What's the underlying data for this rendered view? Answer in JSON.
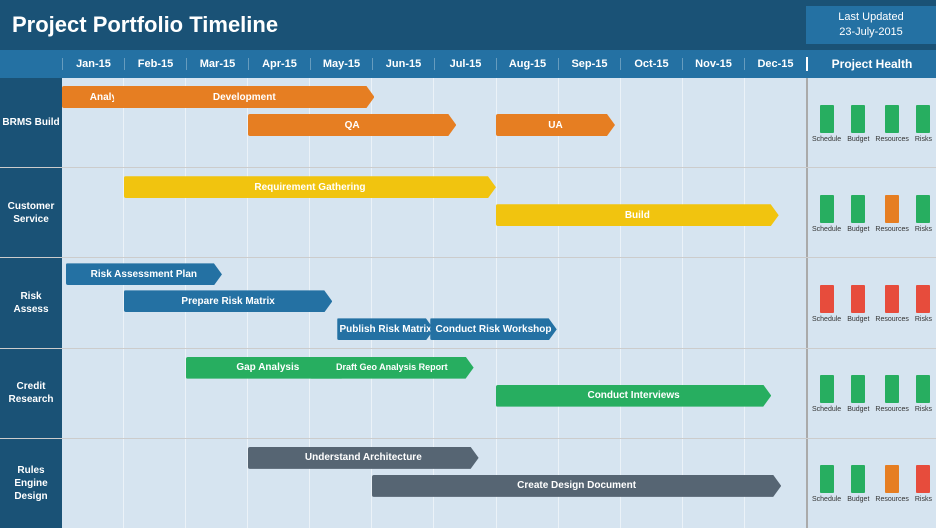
{
  "header": {
    "title": "Project Portfolio Timeline",
    "last_updated_label": "Last Updated",
    "last_updated_date": "23-July-2015",
    "project_health_label": "Project Health"
  },
  "months": [
    "Jan-15",
    "Feb-15",
    "Mar-15",
    "Apr-15",
    "May-15",
    "Jun-15",
    "Jul-15",
    "Aug-15",
    "Sep-15",
    "Oct-15",
    "Nov-15",
    "Dec-15"
  ],
  "rows": [
    {
      "id": "brms-build",
      "label": "BRMS Build",
      "bars": [
        {
          "label": "Analysis",
          "color": "#e67e22",
          "left_pct": 0,
          "width_pct": 14
        },
        {
          "label": "Development",
          "color": "#e67e22",
          "left_pct": 8,
          "width_pct": 35
        },
        {
          "label": "QA",
          "color": "#e67e22",
          "left_pct": 25,
          "width_pct": 30
        },
        {
          "label": "UA",
          "color": "#e67e22",
          "left_pct": 58,
          "width_pct": 18
        }
      ],
      "health": [
        {
          "label": "Schedule",
          "height": 28,
          "color": "bar-green"
        },
        {
          "label": "Budget",
          "height": 28,
          "color": "bar-green"
        },
        {
          "label": "Resources",
          "height": 28,
          "color": "bar-green"
        },
        {
          "label": "Risks",
          "height": 28,
          "color": "bar-green"
        }
      ]
    },
    {
      "id": "customer-service",
      "label": "Customer Service",
      "bars": [
        {
          "label": "Requirement Gathering",
          "color": "#f1c40f",
          "left_pct": 8.33,
          "width_pct": 52
        },
        {
          "label": "Build",
          "color": "#f1c40f",
          "left_pct": 58.33,
          "width_pct": 40
        }
      ],
      "health": [
        {
          "label": "Schedule",
          "height": 28,
          "color": "bar-green"
        },
        {
          "label": "Budget",
          "height": 28,
          "color": "bar-green"
        },
        {
          "label": "Resources",
          "height": 28,
          "color": "bar-orange"
        },
        {
          "label": "Risks",
          "height": 28,
          "color": "bar-green"
        }
      ]
    },
    {
      "id": "risk-assess",
      "label": "Risk Assess",
      "bars": [
        {
          "label": "Risk Assessment Plan",
          "color": "#2471a3",
          "left_pct": 0,
          "width_pct": 22
        },
        {
          "label": "Prepare Risk Matrix",
          "color": "#2471a3",
          "left_pct": 8.33,
          "width_pct": 30
        },
        {
          "label": "Publish Risk Matrix",
          "color": "#2471a3",
          "left_pct": 38.33,
          "width_pct": 13
        },
        {
          "label": "Conduct Risk Workshop",
          "color": "#2471a3",
          "left_pct": 50,
          "width_pct": 16
        }
      ],
      "health": [
        {
          "label": "Schedule",
          "height": 28,
          "color": "bar-red"
        },
        {
          "label": "Budget",
          "height": 28,
          "color": "bar-red"
        },
        {
          "label": "Resources",
          "height": 28,
          "color": "bar-red"
        },
        {
          "label": "Risks",
          "height": 28,
          "color": "bar-red"
        }
      ]
    },
    {
      "id": "credit-research",
      "label": "Credit Research",
      "bars": [
        {
          "label": "Gap Analysis",
          "color": "#27ae60",
          "left_pct": 16.67,
          "width_pct": 25
        },
        {
          "label": "Draft Geo Analysis Report",
          "color": "#27ae60",
          "left_pct": 33.33,
          "width_pct": 25
        },
        {
          "label": "Conduct Interviews",
          "color": "#27ae60",
          "left_pct": 58.33,
          "width_pct": 38
        }
      ],
      "health": [
        {
          "label": "Schedule",
          "height": 28,
          "color": "bar-green"
        },
        {
          "label": "Budget",
          "height": 28,
          "color": "bar-green"
        },
        {
          "label": "Resources",
          "height": 28,
          "color": "bar-green"
        },
        {
          "label": "Risks",
          "height": 28,
          "color": "bar-green"
        }
      ]
    },
    {
      "id": "rules-engine-design",
      "label": "Rules Engine Design",
      "bars": [
        {
          "label": "Understand Architecture",
          "color": "#566573",
          "left_pct": 25,
          "width_pct": 33
        },
        {
          "label": "Create Design Document",
          "color": "#566573",
          "left_pct": 41.67,
          "width_pct": 55
        }
      ],
      "health": [
        {
          "label": "Schedule",
          "height": 28,
          "color": "bar-green"
        },
        {
          "label": "Budget",
          "height": 28,
          "color": "bar-green"
        },
        {
          "label": "Resources",
          "height": 28,
          "color": "bar-orange"
        },
        {
          "label": "Risks",
          "height": 28,
          "color": "bar-red"
        }
      ]
    }
  ],
  "health_labels": [
    "Schedule",
    "Budget",
    "Resources",
    "Risks"
  ]
}
